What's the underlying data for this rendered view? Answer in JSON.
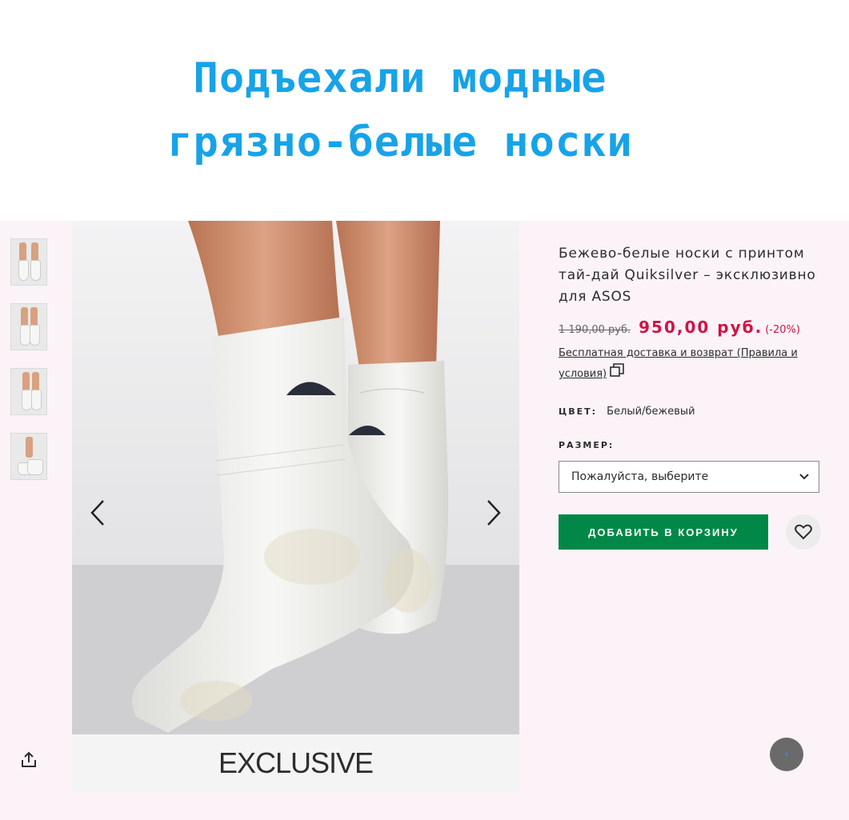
{
  "headline": {
    "line1": "Подъехали модные",
    "line2": "грязно-белые носки"
  },
  "product": {
    "title": "Бежево-белые носки с принтом тай-дай Quiksilver – эксклюзивно для ASOS",
    "old_price": "1 190,00 руб.",
    "new_price": "950,00 руб.",
    "discount": "(-20%)",
    "delivery_text": "Бесплатная доставка и возврат (Правила и условия)",
    "color_label": "ЦВЕТ:",
    "color_value": "Белый/бежевый",
    "size_label": "РАЗМЕР:",
    "size_placeholder": "Пожалуйста, выберите",
    "add_to_cart": "ДОБАВИТЬ В КОРЗИНУ"
  },
  "gallery": {
    "badge": "EXCLUSIVE",
    "thumbnail_count": 4
  },
  "colors": {
    "headline": "#17a3e8",
    "price": "#d01345",
    "add_button": "#018849",
    "panel_bg": "#fbf3f7"
  },
  "icons": [
    "chevron-left-icon",
    "chevron-right-icon",
    "share-icon",
    "external-link-icon",
    "chevron-down-icon",
    "heart-icon",
    "chat-icon"
  ]
}
